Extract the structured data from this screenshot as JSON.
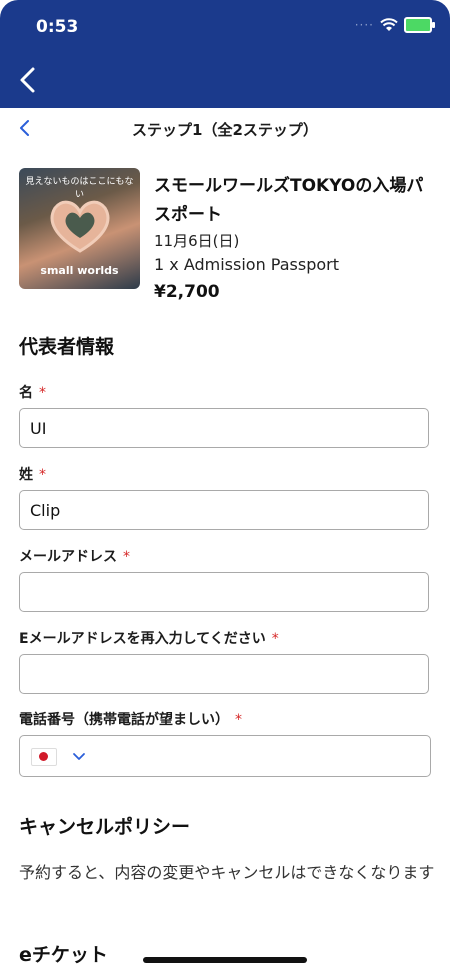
{
  "status": {
    "time": "0:53"
  },
  "nav": {
    "back_icon": "chevron-left-icon"
  },
  "step": {
    "title": "ステップ1（全2ステップ）"
  },
  "product": {
    "thumb_caption": "見えないものはここにもない",
    "thumb_logo": "small worlds",
    "title": "スモールワールズTOKYOの入場パスポート",
    "date": "11月6日(日)",
    "quantity": "1 x Admission Passport",
    "price": "¥2,700"
  },
  "rep": {
    "heading": "代表者情報",
    "first_name": {
      "label": "名",
      "value": "UI"
    },
    "last_name": {
      "label": "姓",
      "value": "Clip"
    },
    "email": {
      "label": "メールアドレス",
      "value": ""
    },
    "email_confirm": {
      "label": "Eメールアドレスを再入力してください",
      "value": ""
    },
    "phone": {
      "label": "電話番号（携帯電話が望ましい）",
      "country": "JP"
    },
    "required_mark": "*"
  },
  "policy": {
    "heading": "キャンセルポリシー",
    "text": "予約すると、内容の変更やキャンセルはできなくなります"
  },
  "ticket": {
    "heading": "eチケット"
  },
  "colors": {
    "brand": "#1b3a8c",
    "required": "#d62828",
    "link": "#2b5fd9"
  }
}
